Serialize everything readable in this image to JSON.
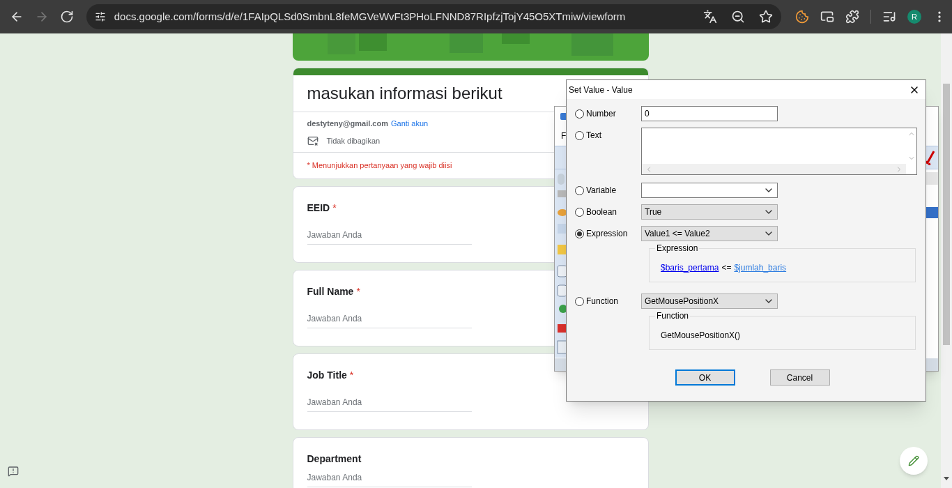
{
  "browser": {
    "nav": [
      {
        "kind": "back",
        "disabled": false
      },
      {
        "kind": "forward",
        "disabled": true
      },
      {
        "kind": "reload",
        "disabled": false
      }
    ],
    "url": "docs.google.com/forms/d/e/1FAIpQLSd0SmbnL8feMGVeWvFt3PHoLFNND87RIpfzjTojY45O5XTmiw/viewform",
    "profile_initial": "R"
  },
  "form": {
    "title": "masukan informasi berikut",
    "email": "destyteny@gmail.com",
    "switch_account": "Ganti akun",
    "not_shared": "Tidak dibagikan",
    "required_note": "* Menunjukkan pertanyaan yang wajib diisi",
    "questions": [
      {
        "label": "EEID",
        "required_mark": "*",
        "placeholder": "Jawaban Anda"
      },
      {
        "label": "Full Name",
        "required_mark": "*",
        "placeholder": "Jawaban Anda"
      },
      {
        "label": "Job Title",
        "required_mark": "*",
        "placeholder": "Jawaban Anda"
      },
      {
        "label": "Department",
        "placeholder": "Jawaban Anda"
      }
    ]
  },
  "background_window": {
    "menu_text": "F"
  },
  "dialog": {
    "title": "Set Value - Value",
    "options": [
      {
        "label": "Number",
        "selected": false,
        "kind": "input",
        "value": "0"
      },
      {
        "label": "Text",
        "selected": false,
        "kind": "textarea"
      },
      {
        "label": "Variable",
        "selected": false,
        "kind": "combo"
      },
      {
        "label": "Boolean",
        "selected": false,
        "kind": "select",
        "value": "True"
      },
      {
        "label": "Expression",
        "selected": true,
        "kind": "select",
        "value": "Value1 <= Value2",
        "group": {
          "legend": "Expression",
          "tokens": [
            {
              "kind": "link",
              "text": "$baris_pertama",
              "color": "#0000ee"
            },
            {
              "kind": "op",
              "text": "<="
            },
            {
              "kind": "link",
              "text": "$jumlah_baris",
              "color": "#2f7de1"
            }
          ]
        }
      },
      {
        "label": "Function",
        "selected": false,
        "kind": "select",
        "value": "GetMousePositionX",
        "group": {
          "legend": "Function",
          "tokens": [
            {
              "kind": "plain",
              "text": "GetMousePositionX()"
            }
          ]
        }
      }
    ],
    "buttons": [
      {
        "label": "OK",
        "default": true
      },
      {
        "label": "Cancel",
        "default": false
      }
    ]
  }
}
